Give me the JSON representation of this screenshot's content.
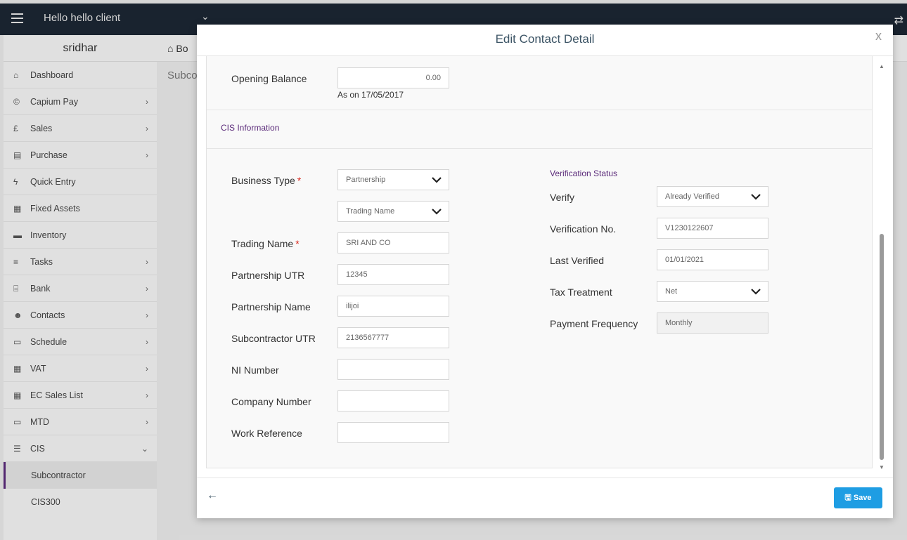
{
  "topbar": {
    "client": "Hello hello client"
  },
  "sidebar": {
    "user": "sridhar",
    "items": [
      {
        "label": "Dashboard",
        "icon": "home-icon",
        "arrow": ""
      },
      {
        "label": "Capium Pay",
        "icon": "capium-icon",
        "arrow": "›"
      },
      {
        "label": "Sales",
        "icon": "pound-icon",
        "arrow": "›"
      },
      {
        "label": "Purchase",
        "icon": "purchase-icon",
        "arrow": "›"
      },
      {
        "label": "Quick Entry",
        "icon": "bolt-icon",
        "arrow": ""
      },
      {
        "label": "Fixed Assets",
        "icon": "building-icon",
        "arrow": ""
      },
      {
        "label": "Inventory",
        "icon": "truck-icon",
        "arrow": ""
      },
      {
        "label": "Tasks",
        "icon": "tasks-icon",
        "arrow": "›"
      },
      {
        "label": "Bank",
        "icon": "bank-icon",
        "arrow": "›"
      },
      {
        "label": "Contacts",
        "icon": "users-icon",
        "arrow": "›"
      },
      {
        "label": "Schedule",
        "icon": "calendar-icon",
        "arrow": "›"
      },
      {
        "label": "VAT",
        "icon": "calculator-icon",
        "arrow": "›"
      },
      {
        "label": "EC Sales List",
        "icon": "calculator-icon",
        "arrow": "›"
      },
      {
        "label": "MTD",
        "icon": "calendar-icon",
        "arrow": "›"
      },
      {
        "label": "CIS",
        "icon": "list-icon",
        "arrow": "⌄"
      }
    ],
    "sub_items": [
      "Subcontractor",
      "CIS300"
    ]
  },
  "background": {
    "breadcrumb": "Bo",
    "page_title": "Subco"
  },
  "modal": {
    "title": "Edit Contact Detail",
    "close": "x",
    "opening_balance_label": "Opening Balance",
    "opening_balance_value": "0.00",
    "as_on": "As on 17/05/2017",
    "cis_section": "CIS Information",
    "business_type_label": "Business Type",
    "business_type_value": "Partnership",
    "trading_name_select": "Trading Name",
    "trading_name_label": "Trading Name",
    "trading_name_value": "SRI AND CO",
    "partnership_utr_label": "Partnership UTR",
    "partnership_utr_value": "12345",
    "partnership_name_label": "Partnership Name",
    "partnership_name_value": "ilijoi",
    "subcontractor_utr_label": "Subcontractor UTR",
    "subcontractor_utr_value": "2136567777",
    "ni_number_label": "NI Number",
    "company_number_label": "Company Number",
    "work_reference_label": "Work Reference",
    "verification_status": "Verification Status",
    "verify_label": "Verify",
    "verify_value": "Already Verified",
    "verification_no_label": "Verification No.",
    "verification_no_value": "V1230122607",
    "last_verified_label": "Last Verified",
    "last_verified_value": "01/01/2021",
    "tax_treatment_label": "Tax Treatment",
    "tax_treatment_value": "Net",
    "payment_frequency_label": "Payment Frequency",
    "payment_frequency_value": "Monthly",
    "save_label": "Save",
    "required_mark": "*"
  },
  "colors": {
    "accent": "#5b2b7a",
    "button": "#1e9de3",
    "topbar": "#1c2733"
  }
}
